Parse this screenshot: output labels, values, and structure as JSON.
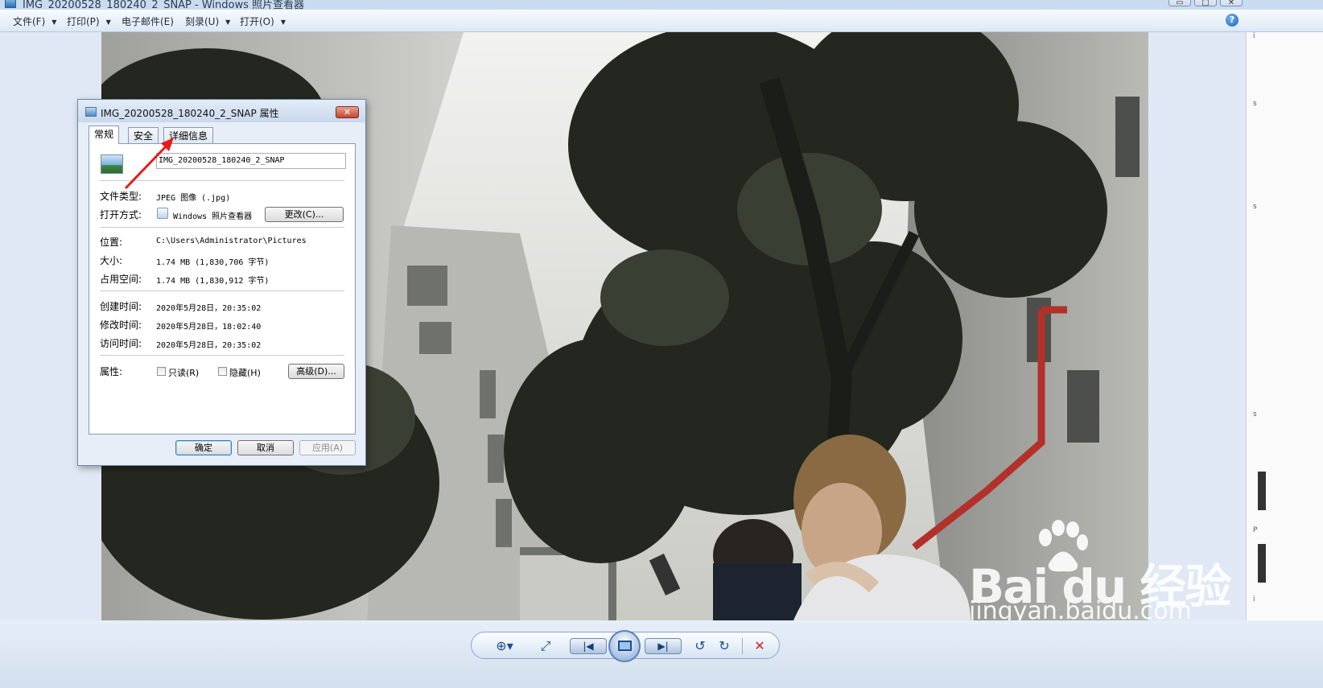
{
  "window": {
    "title": "IMG_20200528_180240_2_SNAP - Windows 照片查看器",
    "minimize_label": "▭",
    "maximize_label": "▢",
    "close_label": "✕"
  },
  "menu": {
    "items": [
      {
        "label": "文件(F)"
      },
      {
        "label": "打印(P)"
      },
      {
        "label": "电子邮件(E)"
      },
      {
        "label": "刻录(U)"
      },
      {
        "label": "打开(O)"
      }
    ],
    "help_label": "?"
  },
  "right_sliver": {
    "fragments": [
      "i",
      "s",
      "s",
      "s",
      "P",
      "i"
    ]
  },
  "watermark": {
    "brand": "Bai du 经验",
    "domain": "jingyan.baidu.com"
  },
  "dialog": {
    "title": "IMG_20200528_180240_2_SNAP 属性",
    "close_label": "✕",
    "tabs": [
      {
        "label": "常规",
        "active": true
      },
      {
        "label": "安全",
        "active": false
      },
      {
        "label": "详细信息",
        "active": false
      }
    ],
    "file_name": "IMG_20200528_180240_2_SNAP",
    "rows": {
      "file_type_label": "文件类型:",
      "file_type_value": "JPEG 图像 (.jpg)",
      "open_with_label": "打开方式:",
      "open_with_value": "Windows 照片查看器",
      "change_button": "更改(C)...",
      "location_label": "位置:",
      "location_value": "C:\\Users\\Administrator\\Pictures",
      "size_label": "大小:",
      "size_value": "1.74 MB (1,830,706 字节)",
      "disk_size_label": "占用空间:",
      "disk_size_value": "1.74 MB (1,830,912 字节)",
      "created_label": "创建时间:",
      "created_value": "2020年5月28日，20:35:02",
      "modified_label": "修改时间:",
      "modified_value": "2020年5月28日，18:02:40",
      "accessed_label": "访问时间:",
      "accessed_value": "2020年5月28日，20:35:02",
      "attributes_label": "属性:",
      "readonly_label": "只读(R)",
      "hidden_label": "隐藏(H)",
      "advanced_button": "高级(D)..."
    },
    "buttons": {
      "ok": "确定",
      "cancel": "取消",
      "apply": "应用(A)"
    }
  },
  "toolbar": {
    "zoom_icon": "zoom-icon",
    "fit_icon": "actual-size-icon",
    "prev_icon": "previous-icon",
    "slideshow_icon": "slideshow-icon",
    "next_icon": "next-icon",
    "rotate_ccw_icon": "rotate-left-icon",
    "rotate_cw_icon": "rotate-right-icon",
    "delete_icon": "delete-icon",
    "delete_color": "#d02020"
  }
}
